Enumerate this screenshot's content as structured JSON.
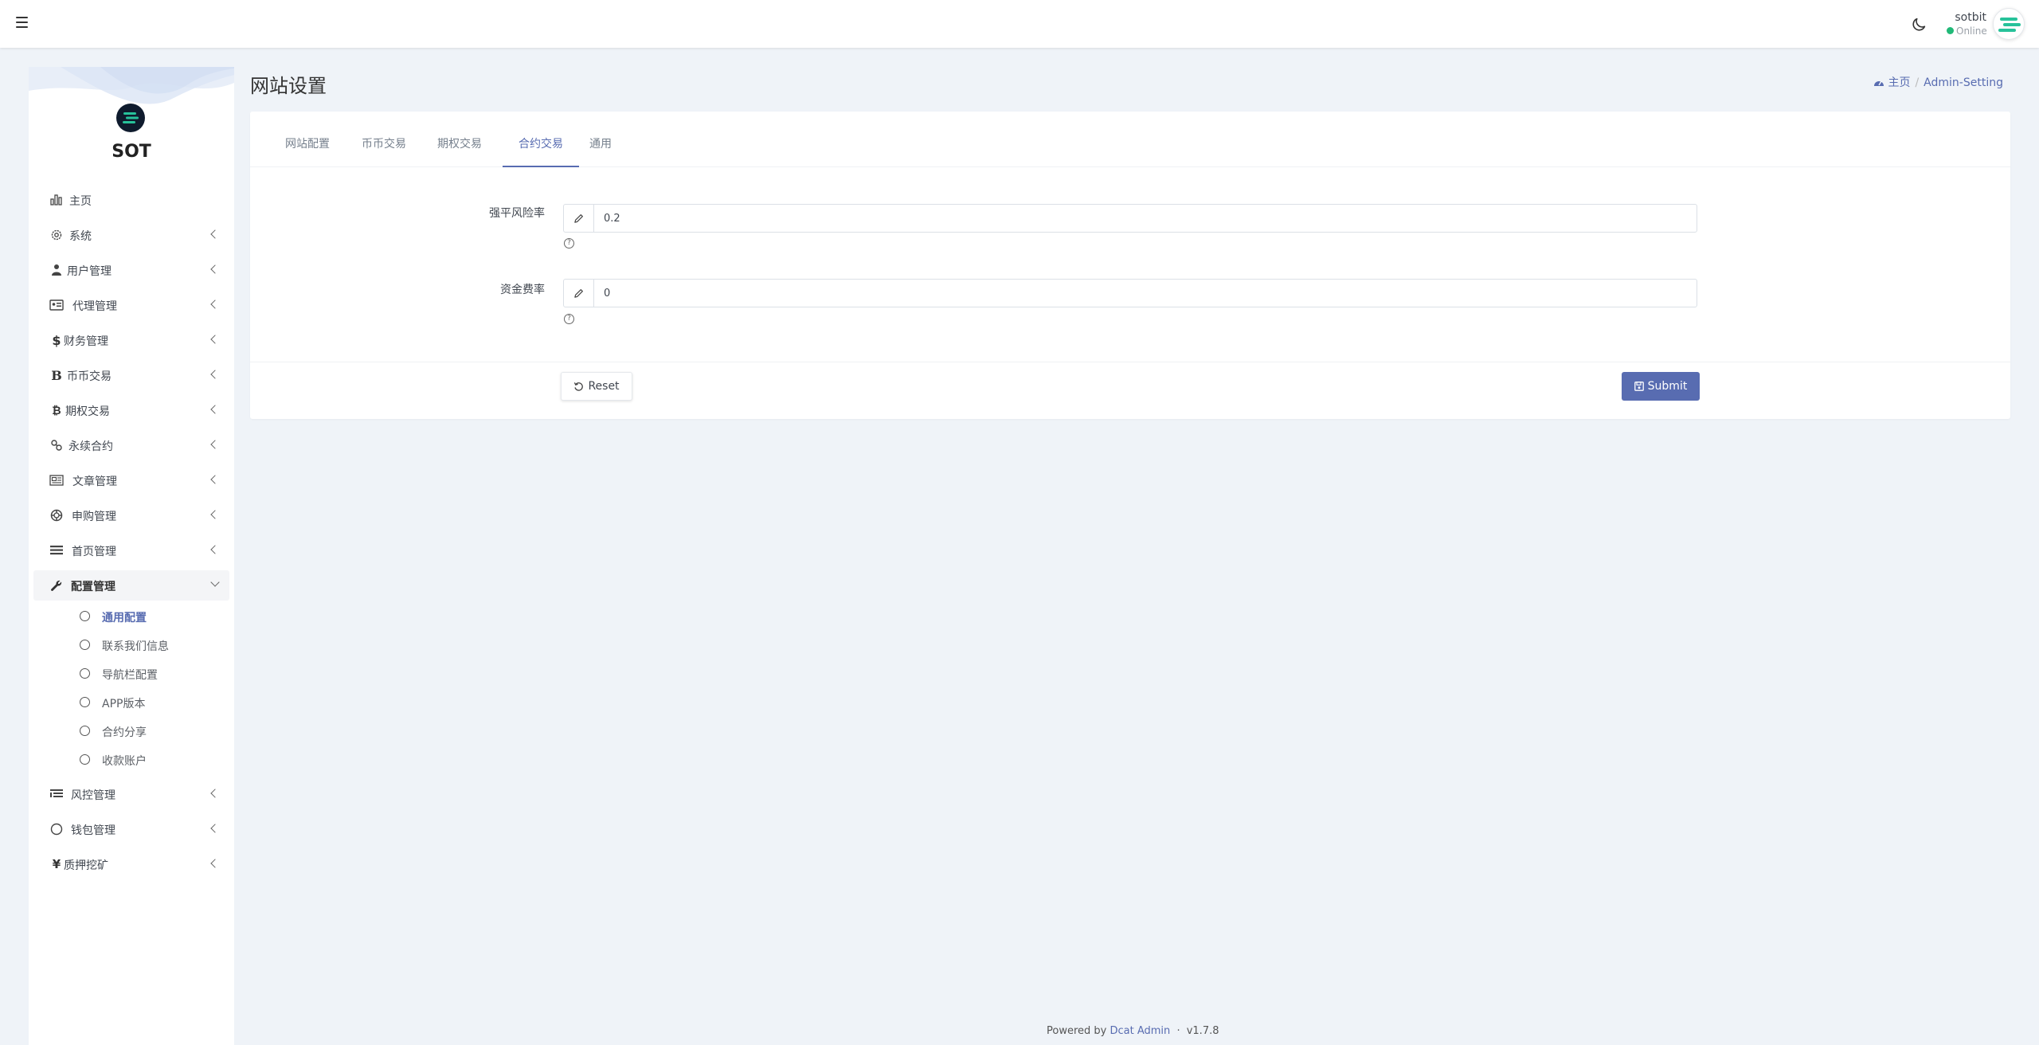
{
  "navbar": {
    "user_name": "sotbit",
    "user_status": "Online"
  },
  "sidebar": {
    "brand": "SOT",
    "items": [
      {
        "label": "主页",
        "icon": "bar-chart-icon"
      },
      {
        "label": "系统",
        "icon": "gear-icon"
      },
      {
        "label": "用户管理",
        "icon": "user-tie-icon"
      },
      {
        "label": "代理管理",
        "icon": "id-card-icon"
      },
      {
        "label": "财务管理",
        "icon": "dollar-icon"
      },
      {
        "label": "币币交易",
        "icon": "b-letter-icon"
      },
      {
        "label": "期权交易",
        "icon": "bitcoin-icon"
      },
      {
        "label": "永续合约",
        "icon": "link-icon"
      },
      {
        "label": "文章管理",
        "icon": "newspaper-icon"
      },
      {
        "label": "申购管理",
        "icon": "lifebuoy-icon"
      },
      {
        "label": "首页管理",
        "icon": "list-icon"
      },
      {
        "label": "配置管理",
        "icon": "wrench-icon"
      },
      {
        "label": "风控管理",
        "icon": "list-indent-icon"
      },
      {
        "label": "钱包管理",
        "icon": "circle-icon"
      },
      {
        "label": "质押挖矿",
        "icon": "yen-icon"
      }
    ],
    "sub_items": [
      {
        "label": "通用配置"
      },
      {
        "label": "联系我们信息"
      },
      {
        "label": "导航栏配置"
      },
      {
        "label": "APP版本"
      },
      {
        "label": "合约分享"
      },
      {
        "label": "收款账户"
      }
    ]
  },
  "header": {
    "title": "网站设置",
    "breadcrumb_home": "主页",
    "breadcrumb_current": "Admin-Setting"
  },
  "tabs": [
    {
      "label": "网站配置"
    },
    {
      "label": "币币交易"
    },
    {
      "label": "期权交易"
    },
    {
      "label": "合约交易"
    },
    {
      "label": "通用"
    }
  ],
  "form": {
    "fields": [
      {
        "label": "强平风险率",
        "value": "0.2"
      },
      {
        "label": "资金费率",
        "value": "0"
      }
    ],
    "reset_label": "Reset",
    "submit_label": "Submit"
  },
  "footer": {
    "prefix": "Powered by",
    "link": "Dcat Admin",
    "separator": "·",
    "version": "v1.7.8"
  },
  "colors": {
    "accent": "#586cb1",
    "online": "#21b978",
    "background": "#eff3f8"
  }
}
